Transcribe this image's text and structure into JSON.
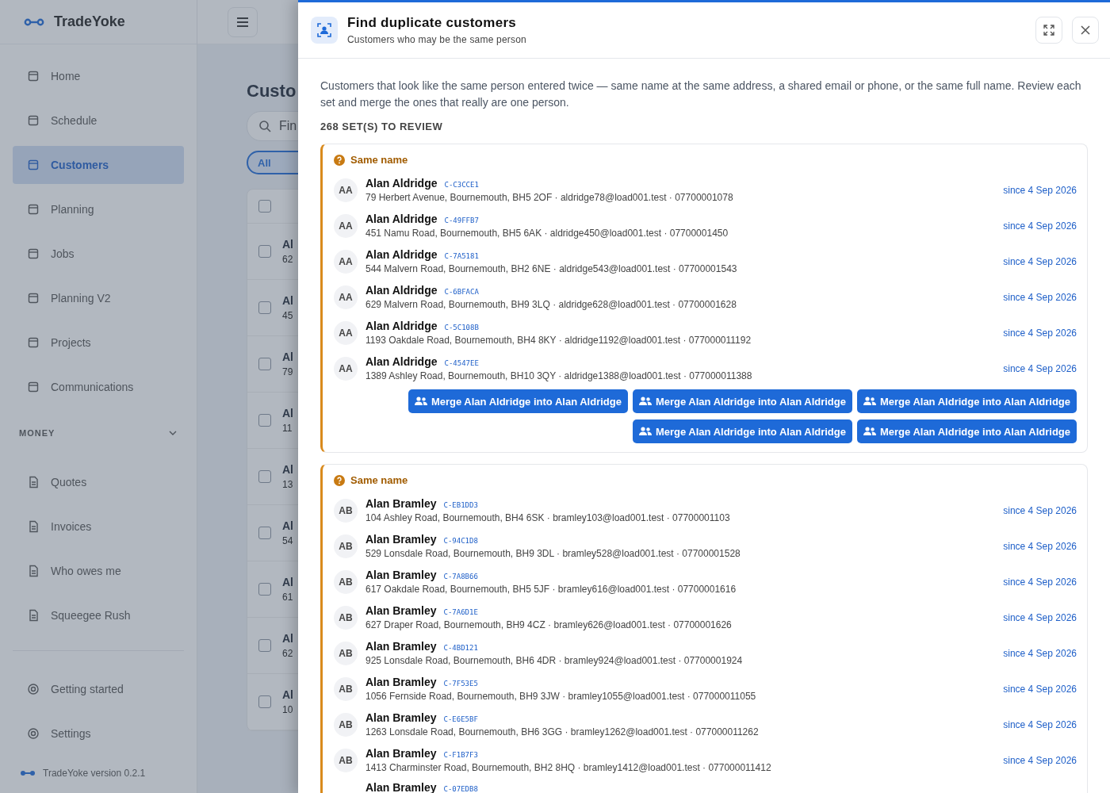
{
  "sidebar": {
    "brand": "TradeYoke",
    "nav": [
      {
        "label": "Home",
        "selected": false
      },
      {
        "label": "Schedule",
        "selected": false
      },
      {
        "label": "Customers",
        "selected": true
      },
      {
        "label": "Planning",
        "selected": false
      },
      {
        "label": "Jobs",
        "selected": false
      },
      {
        "label": "Planning V2",
        "selected": false
      },
      {
        "label": "Projects",
        "selected": false
      },
      {
        "label": "Communications",
        "selected": false
      }
    ],
    "money": {
      "title": "MONEY",
      "expanded": true,
      "items": [
        {
          "label": "Quotes",
          "selected": false
        },
        {
          "label": "Invoices",
          "selected": false
        },
        {
          "label": "Who owes me",
          "selected": false
        },
        {
          "label": "Squeegee Rush",
          "selected": false
        }
      ]
    },
    "footer_items": [
      {
        "label": "Getting started",
        "selected": false
      },
      {
        "label": "Settings",
        "selected": false
      }
    ],
    "version": "TradeYoke version 0.2.1"
  },
  "page": {
    "title": "Custo",
    "search_placeholder": "Fin",
    "filter_chip": "All",
    "select_all_checked": false,
    "rows": [
      {
        "name": "Al",
        "detail": "62",
        "checked": false
      },
      {
        "name": "Al",
        "detail": "45",
        "checked": false
      },
      {
        "name": "Al",
        "detail": "79",
        "checked": false
      },
      {
        "name": "Al",
        "detail": "11",
        "checked": false
      },
      {
        "name": "Al",
        "detail": "13",
        "checked": false
      },
      {
        "name": "Al",
        "detail": "54",
        "checked": false
      },
      {
        "name": "Al",
        "detail": "61",
        "checked": false
      },
      {
        "name": "Al",
        "detail": "62",
        "checked": false
      },
      {
        "name": "Al",
        "detail": "10",
        "checked": false
      }
    ]
  },
  "dialog": {
    "title": "Find duplicate customers",
    "subtitle": "Customers who may be the same person",
    "intro": "Customers that look like the same person entered twice — same name at the same address, a shared email or phone, or the same full name. Review each set and merge the ones that really are one person.",
    "count_label": "268 SET(S) TO REVIEW",
    "groups": [
      {
        "reason": "Same name",
        "customers": [
          {
            "initials": "AA",
            "name": "Alan Aldridge",
            "code": "C-C3CCE1",
            "details": "79 Herbert Avenue, Bournemouth, BH5 2OF · aldridge78@load001.test · 07700001078",
            "since": "since 4 Sep 2026"
          },
          {
            "initials": "AA",
            "name": "Alan Aldridge",
            "code": "C-49FFB7",
            "details": "451 Namu Road, Bournemouth, BH5 6AK · aldridge450@load001.test · 07700001450",
            "since": "since 4 Sep 2026"
          },
          {
            "initials": "AA",
            "name": "Alan Aldridge",
            "code": "C-7A5181",
            "details": "544 Malvern Road, Bournemouth, BH2 6NE · aldridge543@load001.test · 07700001543",
            "since": "since 4 Sep 2026"
          },
          {
            "initials": "AA",
            "name": "Alan Aldridge",
            "code": "C-6BFACA",
            "details": "629 Malvern Road, Bournemouth, BH9 3LQ · aldridge628@load001.test · 07700001628",
            "since": "since 4 Sep 2026"
          },
          {
            "initials": "AA",
            "name": "Alan Aldridge",
            "code": "C-5C108B",
            "details": "1193 Oakdale Road, Bournemouth, BH4 8KY · aldridge1192@load001.test · 077000011192",
            "since": "since 4 Sep 2026"
          },
          {
            "initials": "AA",
            "name": "Alan Aldridge",
            "code": "C-4547EE",
            "details": "1389 Ashley Road, Bournemouth, BH10 3QY · aldridge1388@load001.test · 077000011388",
            "since": "since 4 Sep 2026"
          }
        ],
        "merge_buttons": [
          "Merge Alan Aldridge into Alan Aldridge",
          "Merge Alan Aldridge into Alan Aldridge",
          "Merge Alan Aldridge into Alan Aldridge",
          "Merge Alan Aldridge into Alan Aldridge",
          "Merge Alan Aldridge into Alan Aldridge"
        ]
      },
      {
        "reason": "Same name",
        "customers": [
          {
            "initials": "AB",
            "name": "Alan Bramley",
            "code": "C-EB1DD3",
            "details": "104 Ashley Road, Bournemouth, BH4 6SK · bramley103@load001.test · 07700001103",
            "since": "since 4 Sep 2026"
          },
          {
            "initials": "AB",
            "name": "Alan Bramley",
            "code": "C-94C1D8",
            "details": "529 Lonsdale Road, Bournemouth, BH9 3DL · bramley528@load001.test · 07700001528",
            "since": "since 4 Sep 2026"
          },
          {
            "initials": "AB",
            "name": "Alan Bramley",
            "code": "C-7A8B66",
            "details": "617 Oakdale Road, Bournemouth, BH5 5JF · bramley616@load001.test · 07700001616",
            "since": "since 4 Sep 2026"
          },
          {
            "initials": "AB",
            "name": "Alan Bramley",
            "code": "C-7A6D1E",
            "details": "627 Draper Road, Bournemouth, BH9 4CZ · bramley626@load001.test · 07700001626",
            "since": "since 4 Sep 2026"
          },
          {
            "initials": "AB",
            "name": "Alan Bramley",
            "code": "C-4BD121",
            "details": "925 Lonsdale Road, Bournemouth, BH6 4DR · bramley924@load001.test · 07700001924",
            "since": "since 4 Sep 2026"
          },
          {
            "initials": "AB",
            "name": "Alan Bramley",
            "code": "C-7F53E5",
            "details": "1056 Fernside Road, Bournemouth, BH9 3JW · bramley1055@load001.test · 077000011055",
            "since": "since 4 Sep 2026"
          },
          {
            "initials": "AB",
            "name": "Alan Bramley",
            "code": "C-E6E5BF",
            "details": "1263 Lonsdale Road, Bournemouth, BH6 3GG · bramley1262@load001.test · 077000011262",
            "since": "since 4 Sep 2026"
          },
          {
            "initials": "AB",
            "name": "Alan Bramley",
            "code": "C-F1B7F3",
            "details": "1413 Charminster Road, Bournemouth, BH2 8HQ · bramley1412@load001.test · 077000011412",
            "since": "since 4 Sep 2026"
          },
          {
            "name": "Alan Bramley",
            "code": "C-07EDB8"
          }
        ]
      }
    ]
  }
}
